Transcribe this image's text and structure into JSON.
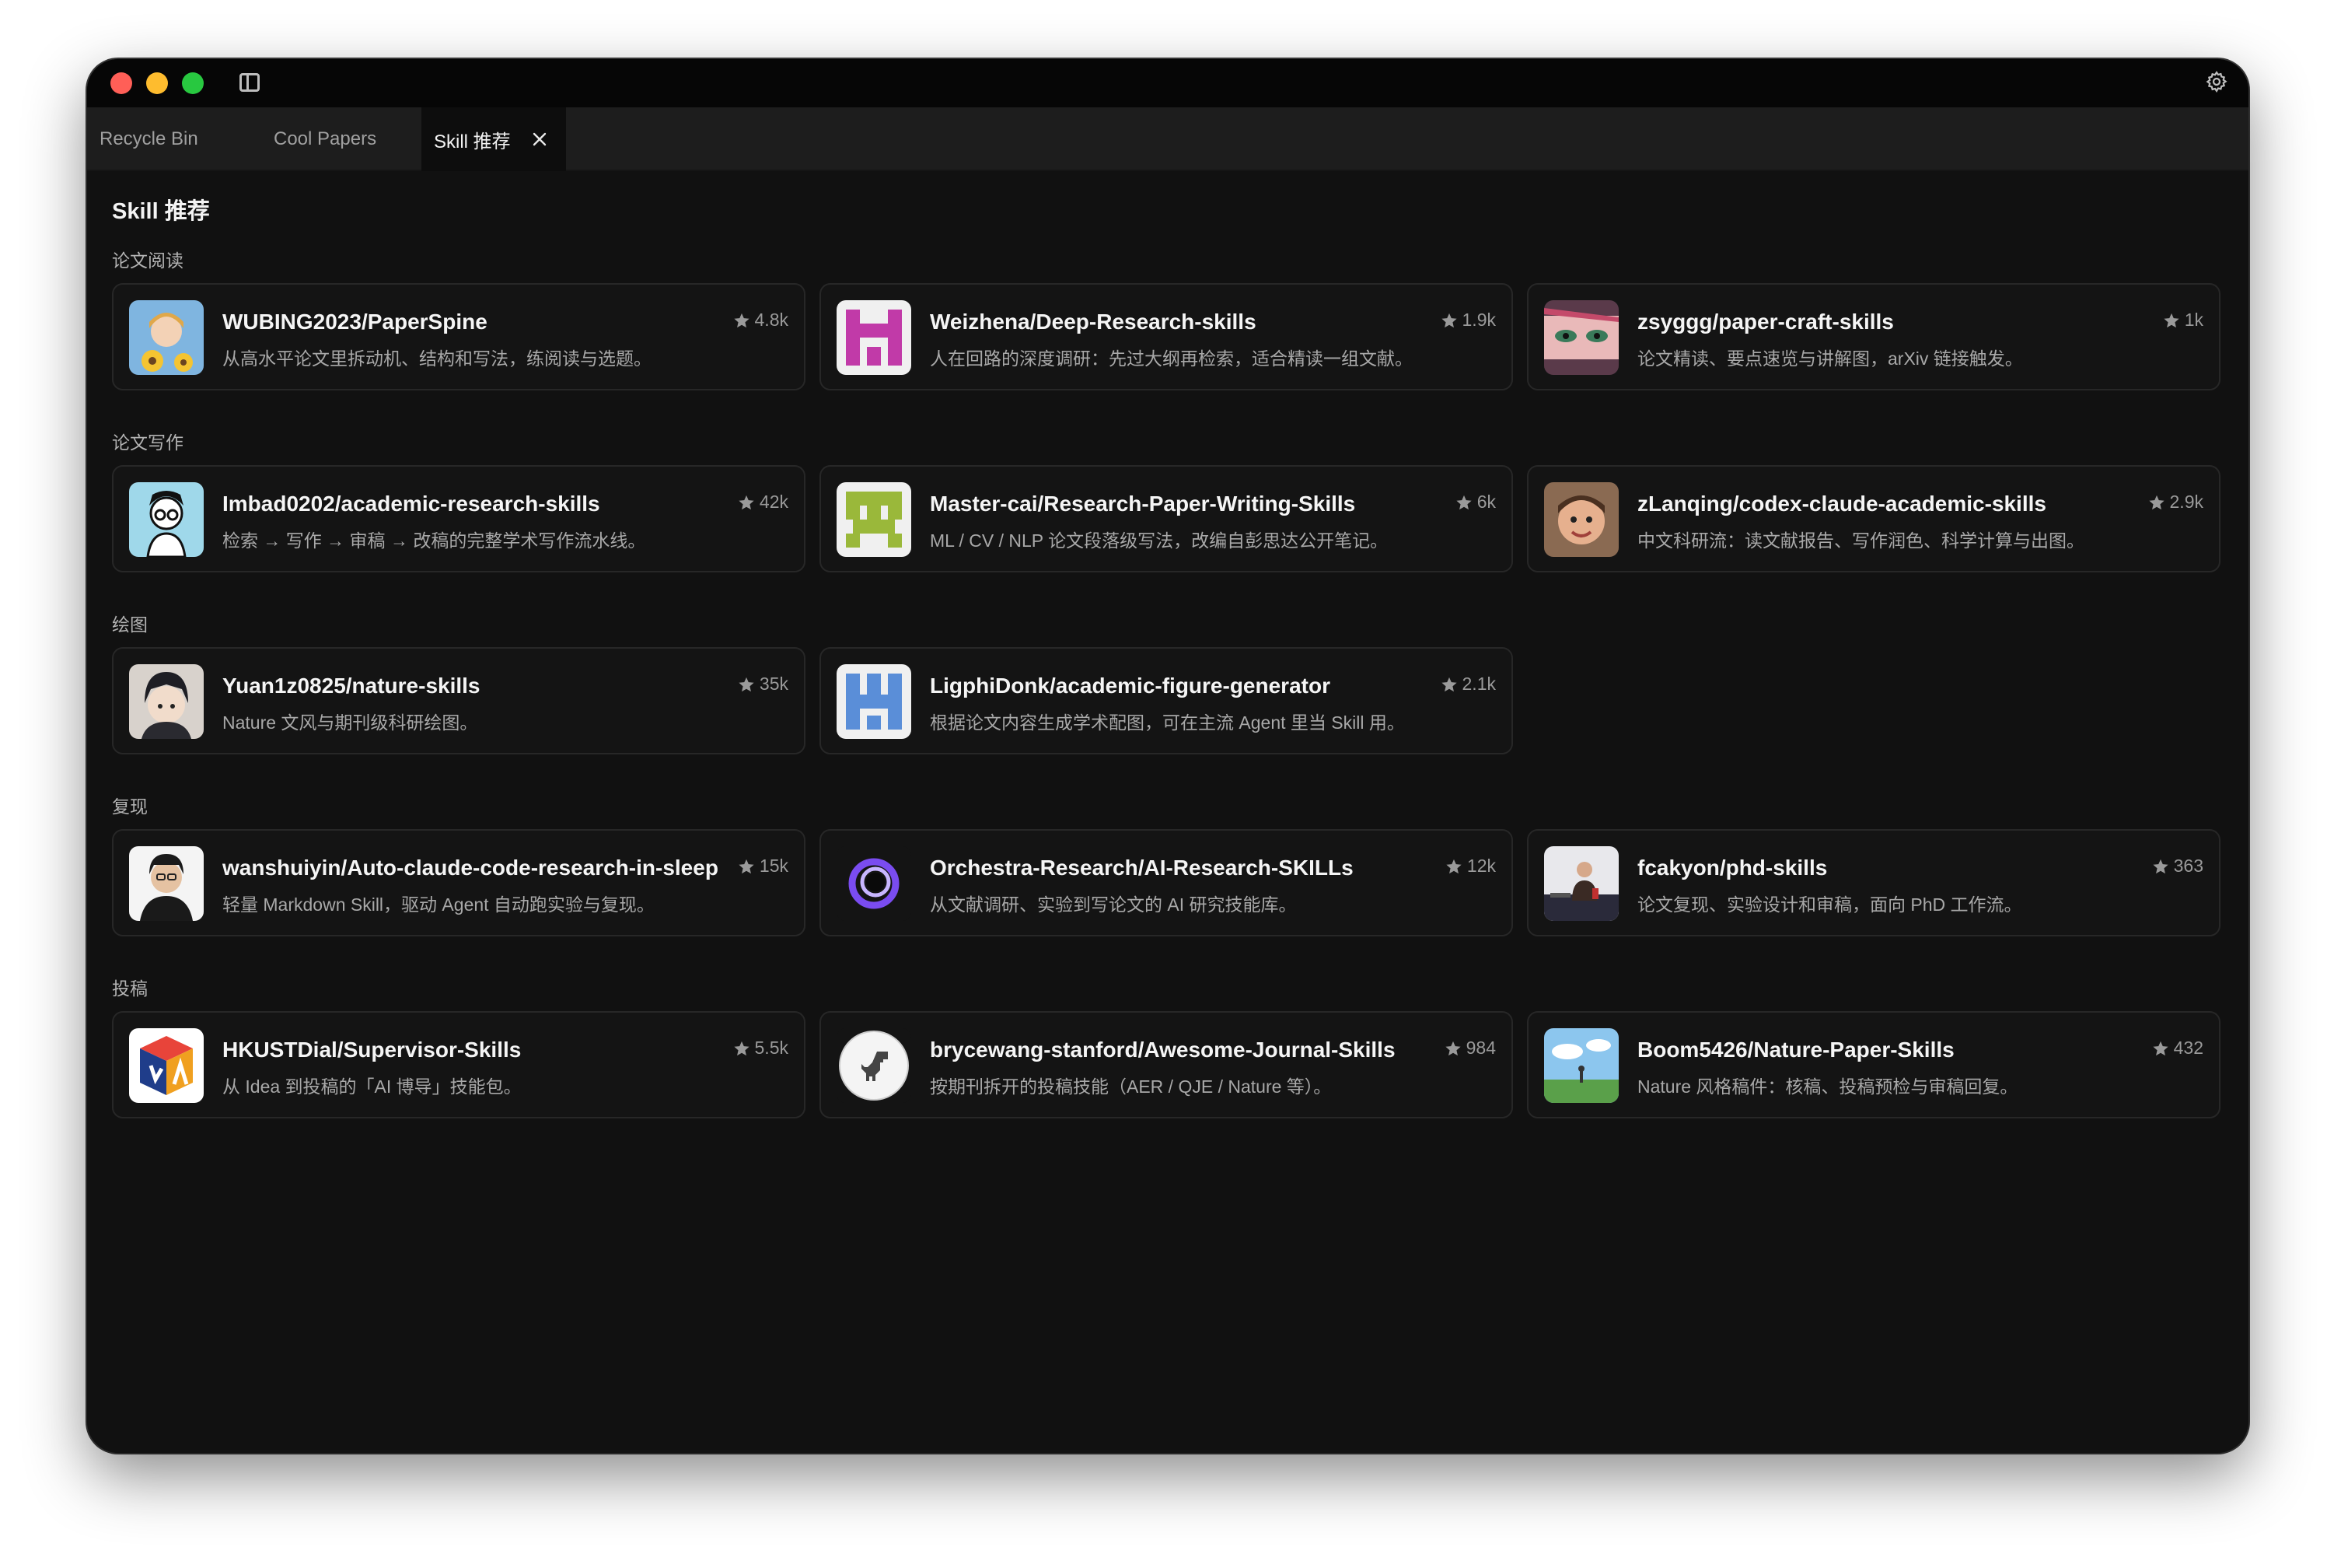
{
  "tabs": [
    {
      "label": "Recycle Bin"
    },
    {
      "label": "Cool Papers"
    },
    {
      "label": "Skill 推荐"
    }
  ],
  "page_title": "Skill 推荐",
  "sections": [
    {
      "label": "论文阅读",
      "cards": [
        {
          "title": "WUBING2023/PaperSpine",
          "desc": "从高水平论文里拆动机、结构和写法，练阅读与选题。",
          "stars": "4.8k",
          "avatar": "anime-girl-sunflower-avatar"
        },
        {
          "title": "Weizhena/Deep-Research-skills",
          "desc": "人在回路的深度调研：先过大纲再检索，适合精读一组文献。",
          "stars": "1.9k",
          "avatar": "pink-identicon-avatar"
        },
        {
          "title": "zsyggg/paper-craft-skills",
          "desc": "论文精读、要点速览与讲解图，arXiv 链接触发。",
          "stars": "1k",
          "avatar": "anime-eyes-avatar"
        }
      ]
    },
    {
      "label": "论文写作",
      "cards": [
        {
          "title": "Imbad0202/academic-research-skills",
          "desc": "检索 → 写作 → 审稿 → 改稿的完整学术写作流水线。",
          "stars": "42k",
          "avatar": "cartoon-scholar-avatar"
        },
        {
          "title": "Master-cai/Research-Paper-Writing-Skills",
          "desc": "ML / CV / NLP 论文段落级写法，改编自彭思达公开笔记。",
          "stars": "6k",
          "avatar": "green-identicon-avatar"
        },
        {
          "title": "zLanqing/codex-claude-academic-skills",
          "desc": "中文科研流：读文献报告、写作润色、科学计算与出图。",
          "stars": "2.9k",
          "avatar": "child-photo-avatar"
        }
      ]
    },
    {
      "label": "绘图",
      "cards": [
        {
          "title": "Yuan1z0825/nature-skills",
          "desc": "Nature 文风与期刊级科研绘图。",
          "stars": "35k",
          "avatar": "anime-boy-avatar"
        },
        {
          "title": "LigphiDonk/academic-figure-generator",
          "desc": "根据论文内容生成学术配图，可在主流 Agent 里当 Skill 用。",
          "stars": "2.1k",
          "avatar": "blue-identicon-avatar"
        }
      ]
    },
    {
      "label": "复现",
      "cards": [
        {
          "title": "wanshuiyin/Auto-claude-code-research-in-sleep",
          "desc": "轻量 Markdown Skill，驱动 Agent 自动跑实验与复现。",
          "stars": "15k",
          "avatar": "man-portrait-avatar"
        },
        {
          "title": "Orchestra-Research/AI-Research-SKILLs",
          "desc": "从文献调研、实验到写论文的 AI 研究技能库。",
          "stars": "12k",
          "avatar": "purple-ring-logo-avatar"
        },
        {
          "title": "fcakyon/phd-skills",
          "desc": "论文复现、实验设计和审稿，面向 PhD 工作流。",
          "stars": "363",
          "avatar": "speaker-photo-avatar"
        }
      ]
    },
    {
      "label": "投稿",
      "cards": [
        {
          "title": "HKUSTDial/Supervisor-Skills",
          "desc": "从 Idea 到投稿的「AI 博导」技能包。",
          "stars": "5.5k",
          "avatar": "colorful-cube-logo-avatar"
        },
        {
          "title": "brycewang-stanford/Awesome-Journal-Skills",
          "desc": "按期刊拆开的投稿技能（AER / QJE / Nature 等）。",
          "stars": "984",
          "avatar": "dinosaur-logo-avatar"
        },
        {
          "title": "Boom5426/Nature-Paper-Skills",
          "desc": "Nature 风格稿件：核稿、投稿预检与审稿回复。",
          "stars": "432",
          "avatar": "sky-landscape-avatar"
        }
      ]
    }
  ]
}
